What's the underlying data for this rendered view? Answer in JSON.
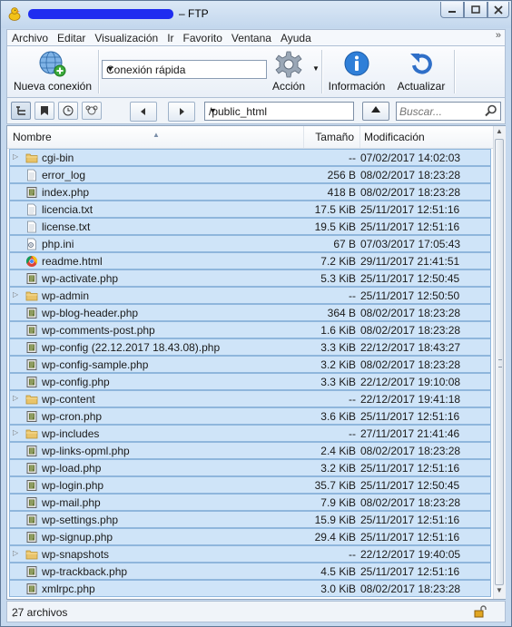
{
  "window": {
    "title": "– FTP"
  },
  "menu": [
    "Archivo",
    "Editar",
    "Visualización",
    "Ir",
    "Favorito",
    "Ventana",
    "Ayuda"
  ],
  "toolbar": {
    "new_connection": "Nueva conexión",
    "quick_connect": "Conexión rápida",
    "action": "Acción",
    "info": "Información",
    "refresh": "Actualizar"
  },
  "nav": {
    "path": "/public_html",
    "search_placeholder": "Buscar..."
  },
  "columns": {
    "name": "Nombre",
    "size": "Tamaño",
    "modified": "Modificación"
  },
  "files": [
    {
      "name": "cgi-bin",
      "size": "--",
      "modified": "07/02/2017 14:02:03",
      "type": "folder"
    },
    {
      "name": "error_log",
      "size": "256 B",
      "modified": "08/02/2017 18:23:28",
      "type": "text"
    },
    {
      "name": "index.php",
      "size": "418 B",
      "modified": "08/02/2017 18:23:28",
      "type": "php"
    },
    {
      "name": "licencia.txt",
      "size": "17.5 KiB",
      "modified": "25/11/2017 12:51:16",
      "type": "text"
    },
    {
      "name": "license.txt",
      "size": "19.5 KiB",
      "modified": "25/11/2017 12:51:16",
      "type": "text"
    },
    {
      "name": "php.ini",
      "size": "67 B",
      "modified": "07/03/2017 17:05:43",
      "type": "ini"
    },
    {
      "name": "readme.html",
      "size": "7.2 KiB",
      "modified": "29/11/2017 21:41:51",
      "type": "html"
    },
    {
      "name": "wp-activate.php",
      "size": "5.3 KiB",
      "modified": "25/11/2017 12:50:45",
      "type": "php"
    },
    {
      "name": "wp-admin",
      "size": "--",
      "modified": "25/11/2017 12:50:50",
      "type": "folder"
    },
    {
      "name": "wp-blog-header.php",
      "size": "364 B",
      "modified": "08/02/2017 18:23:28",
      "type": "php"
    },
    {
      "name": "wp-comments-post.php",
      "size": "1.6 KiB",
      "modified": "08/02/2017 18:23:28",
      "type": "php"
    },
    {
      "name": "wp-config (22.12.2017 18.43.08).php",
      "size": "3.3 KiB",
      "modified": "22/12/2017 18:43:27",
      "type": "php"
    },
    {
      "name": "wp-config-sample.php",
      "size": "3.2 KiB",
      "modified": "08/02/2017 18:23:28",
      "type": "php"
    },
    {
      "name": "wp-config.php",
      "size": "3.3 KiB",
      "modified": "22/12/2017 19:10:08",
      "type": "php"
    },
    {
      "name": "wp-content",
      "size": "--",
      "modified": "22/12/2017 19:41:18",
      "type": "folder"
    },
    {
      "name": "wp-cron.php",
      "size": "3.6 KiB",
      "modified": "25/11/2017 12:51:16",
      "type": "php"
    },
    {
      "name": "wp-includes",
      "size": "--",
      "modified": "27/11/2017 21:41:46",
      "type": "folder"
    },
    {
      "name": "wp-links-opml.php",
      "size": "2.4 KiB",
      "modified": "08/02/2017 18:23:28",
      "type": "php"
    },
    {
      "name": "wp-load.php",
      "size": "3.2 KiB",
      "modified": "25/11/2017 12:51:16",
      "type": "php"
    },
    {
      "name": "wp-login.php",
      "size": "35.7 KiB",
      "modified": "25/11/2017 12:50:45",
      "type": "php"
    },
    {
      "name": "wp-mail.php",
      "size": "7.9 KiB",
      "modified": "08/02/2017 18:23:28",
      "type": "php"
    },
    {
      "name": "wp-settings.php",
      "size": "15.9 KiB",
      "modified": "25/11/2017 12:51:16",
      "type": "php"
    },
    {
      "name": "wp-signup.php",
      "size": "29.4 KiB",
      "modified": "25/11/2017 12:51:16",
      "type": "php"
    },
    {
      "name": "wp-snapshots",
      "size": "--",
      "modified": "22/12/2017 19:40:05",
      "type": "folder"
    },
    {
      "name": "wp-trackback.php",
      "size": "4.5 KiB",
      "modified": "25/11/2017 12:51:16",
      "type": "php"
    },
    {
      "name": "xmlrpc.php",
      "size": "3.0 KiB",
      "modified": "08/02/2017 18:23:28",
      "type": "php"
    }
  ],
  "status": {
    "count": "27 archivos"
  },
  "colors": {
    "row_bg": "#cfe4f8",
    "row_border": "#8fb6dc",
    "frame": "#c6d9ee",
    "redaction": "#1f2df0"
  }
}
